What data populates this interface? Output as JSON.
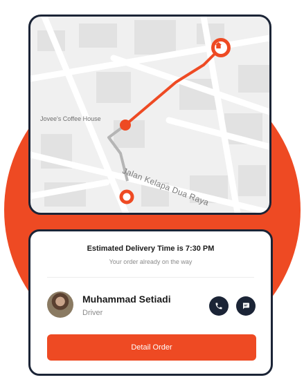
{
  "map": {
    "place_label": "Jovee's Coffee House",
    "street_label": "Jalan Kelapa Dua Raya"
  },
  "delivery": {
    "title": "Estimated Delivery Time is 7:30 PM",
    "subtitle": "Your order already on the way"
  },
  "driver": {
    "name": "Muhammad Setiadi",
    "role": "Driver"
  },
  "actions": {
    "detail_label": "Detail Order"
  },
  "colors": {
    "accent": "#ee4a23",
    "dark": "#1b2436"
  },
  "icons": [
    "home-pin-icon",
    "phone-icon",
    "chat-icon"
  ]
}
